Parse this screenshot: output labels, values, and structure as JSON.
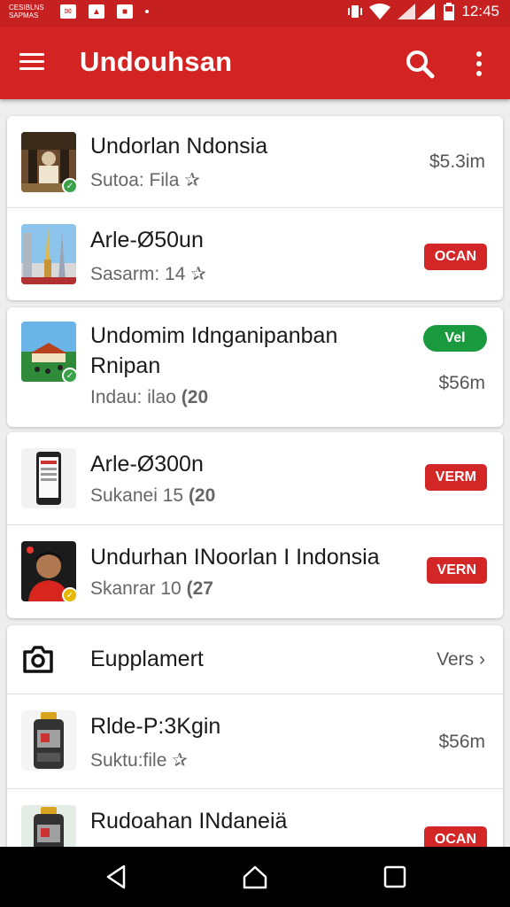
{
  "status_bar": {
    "notification_text": "CESIBLNS SAPMAS",
    "time": "12:45",
    "icons": [
      "mail-icon",
      "image-icon",
      "chat-icon",
      "dot-icon",
      "vibrate-icon",
      "wifi-icon",
      "signal-icon",
      "battery-icon"
    ]
  },
  "app_bar": {
    "title": "Undouhsan",
    "icons": [
      "menu-icon",
      "search-icon",
      "more-vert-icon"
    ]
  },
  "card1": {
    "items": [
      {
        "title": "Undorlan Ndonsia",
        "subtitle": "Sutoa: Fila",
        "count": "",
        "size": "$5.3im",
        "badge": "",
        "thumb": "fort-thumb",
        "check": "green"
      },
      {
        "title": "Arle-Ø50un",
        "subtitle": "Sasarm: 14",
        "count": "",
        "size": "",
        "badge": "OCAN",
        "thumb": "towers-thumb",
        "check": ""
      }
    ]
  },
  "card2": {
    "items": [
      {
        "title": "Undomim Idnganipanban",
        "title2": "Rnipan",
        "subtitle": "Indau: ilao",
        "count": "(20",
        "size": "$56m",
        "badge": "Vel",
        "thumb": "temple-thumb",
        "check": "green"
      }
    ]
  },
  "card3": {
    "items": [
      {
        "title": "Arle-Ø300n",
        "subtitle": "Sukanei 15",
        "count": "(20",
        "size": "",
        "badge": "VERM",
        "thumb": "phone-thumb",
        "check": ""
      },
      {
        "title": "Undurhan INoorlan I Indonsia",
        "subtitle": "Skanrar 10",
        "count": "(27",
        "size": "",
        "badge": "VERN",
        "thumb": "person-thumb",
        "check": "yellow"
      }
    ]
  },
  "card4": {
    "header": {
      "title": "Eupplamert",
      "link": "Vers",
      "icon": "camera-icon"
    },
    "items": [
      {
        "title": "Rlde-P:3Kgin",
        "subtitle": "Suktu:file",
        "count": "",
        "size": "$56m",
        "badge": "",
        "thumb": "device-thumb"
      },
      {
        "title": "Rudoahan INdaneiä",
        "subtitle": "",
        "count": "",
        "size": "",
        "badge": "OCAN",
        "thumb": "device-thumb"
      }
    ]
  },
  "nav_bar": {
    "icons": [
      "back-icon",
      "home-icon",
      "recents-icon"
    ]
  },
  "colors": {
    "primary": "#d32323",
    "status": "#c62020",
    "badge_red": "#d32727",
    "badge_green": "#1a9a3e",
    "check_green": "#3aa34a",
    "check_yellow": "#e6b800"
  }
}
